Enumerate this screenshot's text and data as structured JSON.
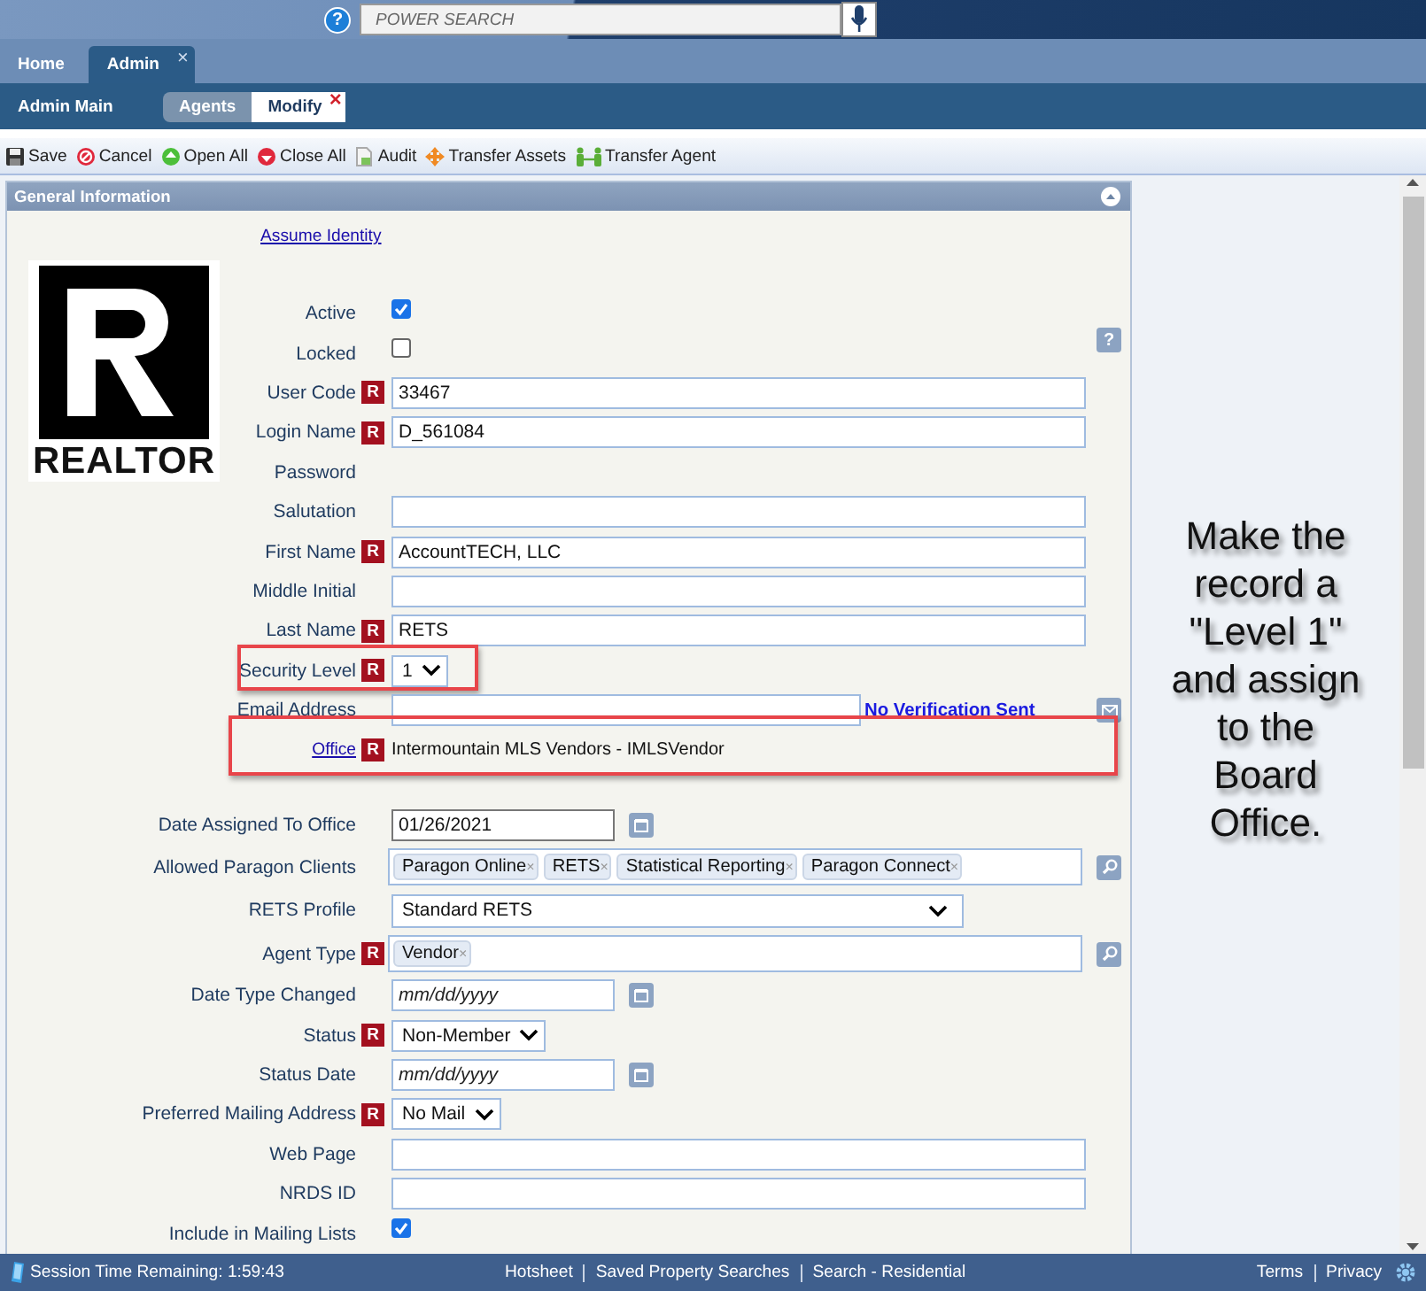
{
  "header": {
    "help": "?",
    "search": {
      "placeholder": "POWER SEARCH"
    }
  },
  "tabs": [
    {
      "label": "Home",
      "selected": false
    },
    {
      "label": "Admin",
      "selected": true,
      "close": "×"
    }
  ],
  "subbar": {
    "title": "Admin Main",
    "tabs": [
      {
        "label": "Agents",
        "selected": false
      },
      {
        "label": "Modify",
        "selected": true,
        "close": "×"
      }
    ]
  },
  "toolbar": [
    {
      "label": "Save",
      "kind": "save"
    },
    {
      "label": "Cancel",
      "kind": "cancel"
    },
    {
      "label": "Open All",
      "kind": "open"
    },
    {
      "label": "Close All",
      "kind": "close"
    },
    {
      "label": "Audit",
      "kind": "audit"
    },
    {
      "label": "Transfer Assets",
      "kind": "move"
    },
    {
      "label": "Transfer Agent",
      "kind": "people"
    }
  ],
  "panel": {
    "title": "General Information",
    "expanded": true,
    "link": "Assume Identity",
    "logo": {
      "text": "REALTOR"
    },
    "groups": [
      {
        "rows": [
          {
            "label": "Active",
            "kind": "checkbox",
            "checked": true
          },
          {
            "label": "Locked",
            "kind": "checkbox",
            "checked": false,
            "help": "?"
          },
          {
            "label": "User Code",
            "kind": "text",
            "required": "R",
            "value": "33467"
          },
          {
            "label": "Login Name",
            "kind": "text",
            "required": "R",
            "value": "D_561084"
          },
          {
            "label": "Password",
            "kind": "none"
          },
          {
            "label": "Salutation",
            "kind": "text",
            "value": ""
          },
          {
            "label": "First Name",
            "kind": "text",
            "required": "R",
            "value": "AccountTECH, LLC"
          },
          {
            "label": "Middle Initial",
            "kind": "text",
            "value": ""
          },
          {
            "label": "Last Name",
            "kind": "text",
            "required": "R",
            "value": "RETS"
          },
          {
            "label": "Security Level",
            "kind": "select",
            "required": "R",
            "value": "1",
            "highlighted": true
          },
          {
            "label": "Email Address",
            "kind": "email",
            "value": "",
            "note": "No Verification Sent"
          },
          {
            "label": "Office",
            "kind": "static",
            "required": "R",
            "label_link": true,
            "value": "Intermountain MLS Vendors - IMLSVendor",
            "highlighted": true
          }
        ]
      },
      {
        "rows": [
          {
            "label": "Date Assigned To Office",
            "kind": "date",
            "value": "01/26/2021"
          },
          {
            "label": "Allowed Paragon Clients",
            "kind": "tags",
            "tags": [
              {
                "label": "Paragon Online",
                "remove": "×"
              },
              {
                "label": "RETS",
                "remove": "×"
              },
              {
                "label": "Statistical Reporting",
                "remove": "×"
              },
              {
                "label": "Paragon Connect",
                "remove": "×"
              }
            ]
          },
          {
            "label": "RETS Profile",
            "kind": "wide-select",
            "value": "Standard RETS"
          },
          {
            "label": "Agent Type",
            "kind": "tags",
            "required": "R",
            "tags": [
              {
                "label": "Vendor",
                "remove": "×"
              }
            ]
          },
          {
            "label": "Date Type Changed",
            "kind": "date",
            "placeholder": "mm/dd/yyyy"
          },
          {
            "label": "Status",
            "kind": "select",
            "required": "R",
            "value": "Non-Member"
          },
          {
            "label": "Status Date",
            "kind": "date",
            "placeholder": "mm/dd/yyyy"
          },
          {
            "label": "Preferred Mailing Address",
            "kind": "select",
            "required": "R",
            "value": "No Mail"
          },
          {
            "label": "Web Page",
            "kind": "text",
            "value": ""
          },
          {
            "label": "NRDS ID",
            "kind": "text",
            "value": ""
          },
          {
            "label": "Include in Mailing Lists",
            "kind": "checkbox",
            "checked": true
          }
        ]
      }
    ]
  },
  "annotation": {
    "text": "Make the record a \"Level 1\" and assign to the Board Office."
  },
  "status_bar": {
    "session": "Session Time Remaining: 1:59:43",
    "links": [
      "Hotsheet",
      "Saved Property Searches",
      "Search - Residential"
    ],
    "right_links": [
      "Terms",
      "Privacy"
    ]
  }
}
